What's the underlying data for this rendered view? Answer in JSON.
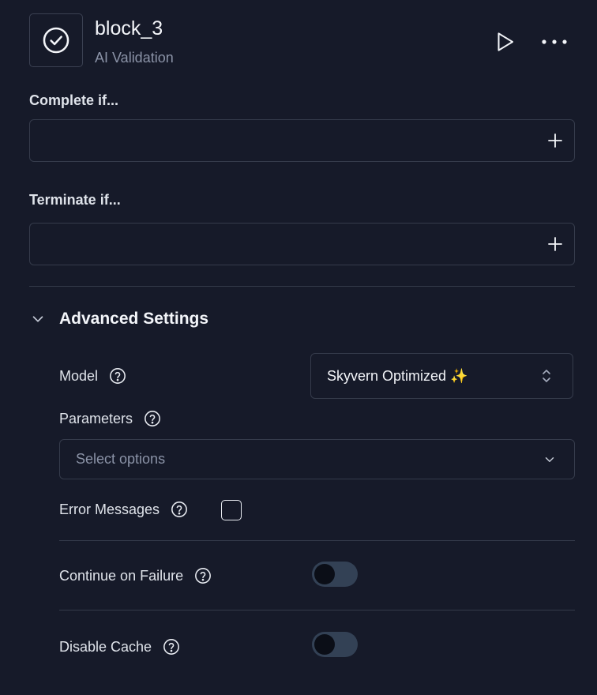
{
  "block": {
    "title": "block_3",
    "subtitle": "AI Validation",
    "icon": "check-circle-icon"
  },
  "header_actions": {
    "run_icon": "play-icon",
    "more_icon": "more-horizontal-icon"
  },
  "complete_if": {
    "label": "Complete if...",
    "value": "",
    "add_icon": "plus-icon"
  },
  "terminate_if": {
    "label": "Terminate if...",
    "value": "",
    "add_icon": "plus-icon"
  },
  "advanced": {
    "title": "Advanced Settings",
    "expanded": true,
    "model": {
      "label": "Model",
      "value": "Skyvern Optimized ✨"
    },
    "parameters": {
      "label": "Parameters",
      "placeholder": "Select options"
    },
    "error_messages": {
      "label": "Error Messages",
      "checked": false
    },
    "continue_on_failure": {
      "label": "Continue on Failure",
      "on": false
    },
    "disable_cache": {
      "label": "Disable Cache",
      "on": false
    }
  }
}
